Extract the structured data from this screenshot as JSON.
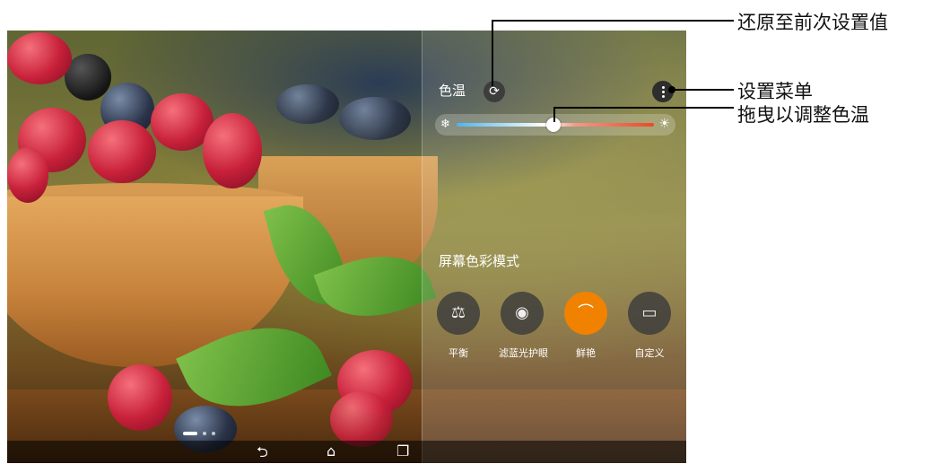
{
  "panel": {
    "title": "色温",
    "reset_icon": "⟳",
    "mode_section_title": "屏幕色彩模式",
    "slider_value_percent": 49,
    "modes": [
      {
        "label": "平衡",
        "icon": "⚖",
        "selected": false
      },
      {
        "label": "滤蓝光护眼",
        "icon": "◉",
        "selected": false
      },
      {
        "label": "鲜艳",
        "icon": "⌒",
        "selected": true
      },
      {
        "label": "自定义",
        "icon": "▭",
        "selected": false
      }
    ],
    "cold_icon": "❄",
    "warm_icon": "☀"
  },
  "callouts": {
    "reset": "还原至前次设置值",
    "menu": "设置菜单",
    "drag": "拖曳以调整色温"
  },
  "navbar": {
    "back_icon": "⮌",
    "home_icon": "⌂",
    "recent_icon": "❐"
  },
  "colors": {
    "accent": "#f08200"
  }
}
